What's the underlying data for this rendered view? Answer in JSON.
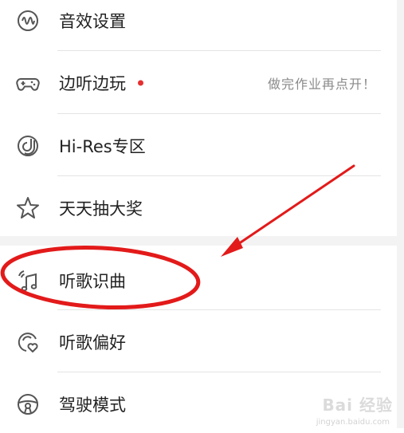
{
  "menu": {
    "items": [
      {
        "label": "音效设置",
        "icon": "sound-wave-icon"
      },
      {
        "label": "边听边玩",
        "icon": "gamepad-icon",
        "hint": "做完作业再点开！",
        "badge_dot": true
      },
      {
        "label": "Hi-Res专区",
        "icon": "hi-res-icon"
      },
      {
        "label": "天天抽大奖",
        "icon": "star-icon"
      },
      {
        "label": "听歌识曲",
        "icon": "music-recognition-icon"
      },
      {
        "label": "听歌偏好",
        "icon": "preference-heart-icon"
      },
      {
        "label": "驾驶模式",
        "icon": "steering-wheel-icon"
      }
    ]
  },
  "watermark": {
    "text": "Bai 经验",
    "subtext": "jingyan.baidu.com"
  },
  "colors": {
    "annotation_red": "#e31a1a",
    "badge_red": "#e62f2f",
    "divider": "#e4e4e4",
    "icon_gray": "#555555"
  }
}
